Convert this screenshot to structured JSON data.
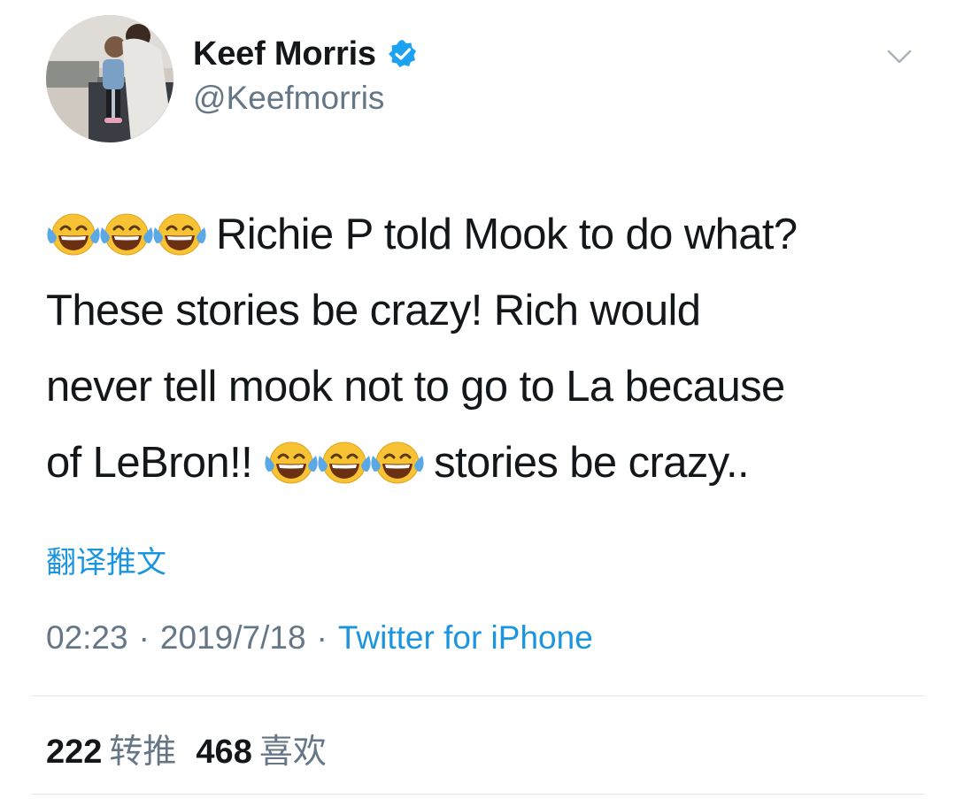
{
  "user": {
    "display_name": "Keef Morris",
    "handle": "@Keefmorris",
    "verified_icon": "verified-badge-icon",
    "avatar_icon": "avatar-photo"
  },
  "menu_icon": "chevron-down-icon",
  "tweet": {
    "lines": [
      "Richie P told Mook to do what?",
      "These stories be crazy! Rich would",
      "never tell mook not to go to La because",
      "of LeBron!!",
      "stories be crazy.."
    ],
    "emoji": "face-with-tears-of-joy-icon"
  },
  "translate_label": "翻译推文",
  "meta": {
    "time": "02:23",
    "separator": "·",
    "date": "2019/7/18",
    "source": "Twitter for iPhone"
  },
  "stats": {
    "retweets_count": "222",
    "retweets_label": "转推",
    "likes_count": "468",
    "likes_label": "喜欢"
  },
  "colors": {
    "link_blue": "#1b95e0",
    "secondary_gray": "#657786",
    "primary_text": "#14171a",
    "divider": "#e1e8ed",
    "verified_blue": "#1da1f2"
  }
}
